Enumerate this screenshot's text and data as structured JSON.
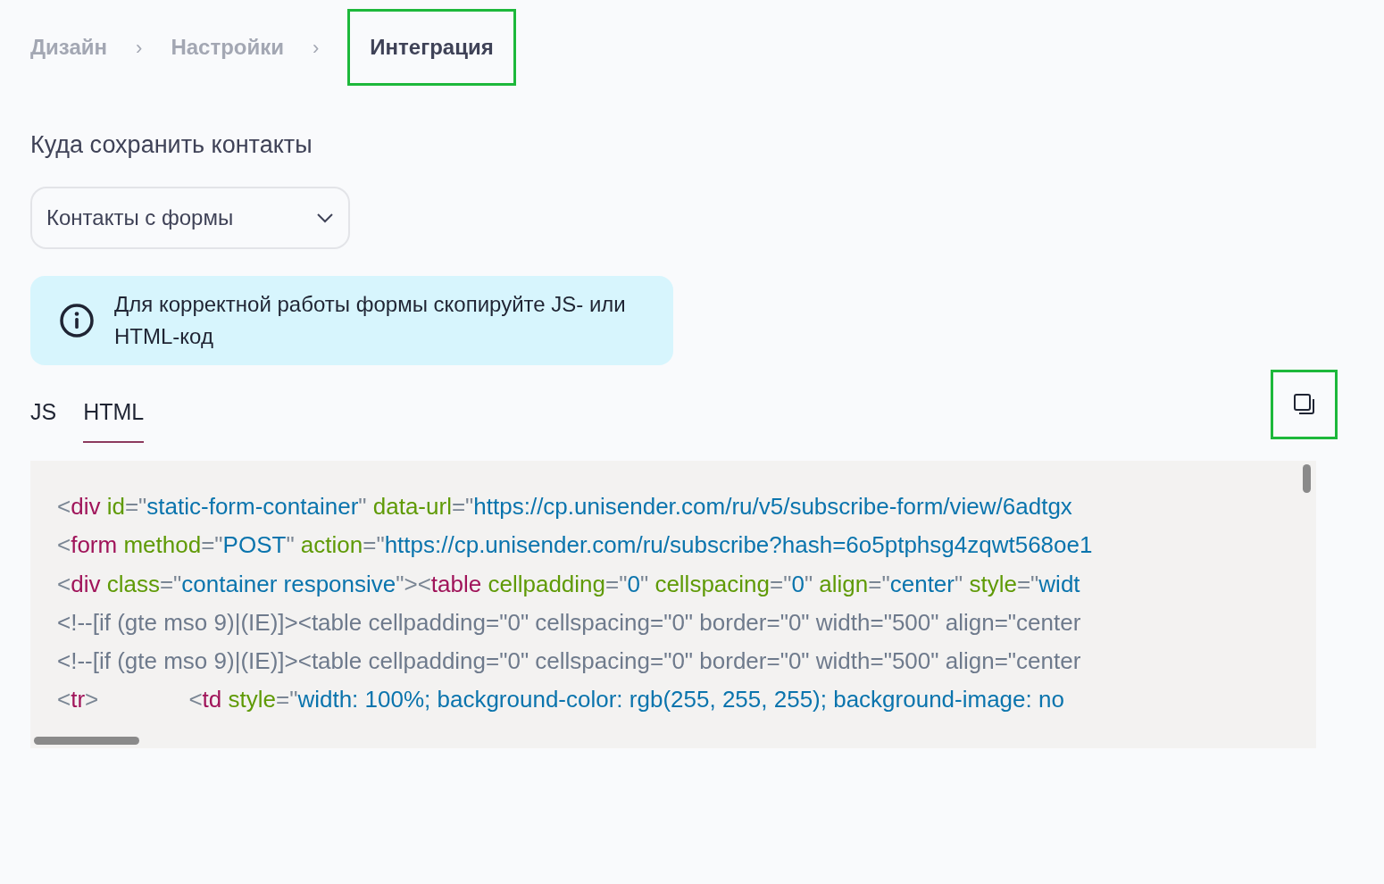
{
  "breadcrumbs": [
    {
      "label": "Дизайн",
      "selected": false,
      "highlighted": false,
      "separator": "›"
    },
    {
      "label": "Настройки",
      "selected": false,
      "highlighted": false,
      "separator": "›"
    },
    {
      "label": "Интеграция",
      "selected": true,
      "highlighted": true
    }
  ],
  "section_title": "Куда сохранить контакты",
  "select": {
    "value": "Контакты с формы"
  },
  "info": {
    "text": "Для корректной работы формы скопируйте JS- или HTML-код"
  },
  "tabs": [
    {
      "label": "JS",
      "selected": false
    },
    {
      "label": "HTML",
      "selected": true
    }
  ],
  "copy_button": {
    "highlighted": true
  },
  "code_lines": [
    [
      {
        "kind": "punct",
        "text": "<"
      },
      {
        "kind": "tag",
        "text": "div "
      },
      {
        "kind": "attr",
        "text": "id"
      },
      {
        "kind": "punct",
        "text": "=\""
      },
      {
        "kind": "value",
        "text": "static-form-container"
      },
      {
        "kind": "punct",
        "text": "\" "
      },
      {
        "kind": "attr",
        "text": "data-url"
      },
      {
        "kind": "punct",
        "text": "=\""
      },
      {
        "kind": "value",
        "text": "https://cp.unisender.com/ru/v5/subscribe-form/view/6adtgx"
      }
    ],
    [
      {
        "kind": "punct",
        "text": "<"
      },
      {
        "kind": "tag",
        "text": "form "
      },
      {
        "kind": "attr",
        "text": "method"
      },
      {
        "kind": "punct",
        "text": "=\""
      },
      {
        "kind": "value",
        "text": "POST"
      },
      {
        "kind": "punct",
        "text": "\" "
      },
      {
        "kind": "attr",
        "text": "action"
      },
      {
        "kind": "punct",
        "text": "=\""
      },
      {
        "kind": "value",
        "text": "https://cp.unisender.com/ru/subscribe?hash=6o5ptphsg4zqwt568oe1"
      }
    ],
    [
      {
        "kind": "punct",
        "text": "<"
      },
      {
        "kind": "tag",
        "text": "div "
      },
      {
        "kind": "attr",
        "text": "class"
      },
      {
        "kind": "punct",
        "text": "=\""
      },
      {
        "kind": "value",
        "text": "container responsive"
      },
      {
        "kind": "punct",
        "text": "\"><"
      },
      {
        "kind": "tag",
        "text": "table "
      },
      {
        "kind": "attr",
        "text": "cellpadding"
      },
      {
        "kind": "punct",
        "text": "=\""
      },
      {
        "kind": "value",
        "text": "0"
      },
      {
        "kind": "punct",
        "text": "\" "
      },
      {
        "kind": "attr",
        "text": "cellspacing"
      },
      {
        "kind": "punct",
        "text": "=\""
      },
      {
        "kind": "value",
        "text": "0"
      },
      {
        "kind": "punct",
        "text": "\" "
      },
      {
        "kind": "attr",
        "text": "align"
      },
      {
        "kind": "punct",
        "text": "=\""
      },
      {
        "kind": "value",
        "text": "center"
      },
      {
        "kind": "punct",
        "text": "\" "
      },
      {
        "kind": "attr",
        "text": "style"
      },
      {
        "kind": "punct",
        "text": "=\""
      },
      {
        "kind": "value",
        "text": "widt"
      }
    ],
    [
      {
        "kind": "comment",
        "text": "<!--[if (gte mso 9)|(IE)]><table cellpadding=\"0\" cellspacing=\"0\" border=\"0\" width=\"500\" align=\"center"
      }
    ],
    [
      {
        "kind": "comment",
        "text": "<!--[if (gte mso 9)|(IE)]><table cellpadding=\"0\" cellspacing=\"0\" border=\"0\" width=\"500\" align=\"center"
      }
    ],
    [
      {
        "kind": "punct",
        "text": "<"
      },
      {
        "kind": "tag",
        "text": "tr"
      },
      {
        "kind": "punct",
        "text": ">              <"
      },
      {
        "kind": "tag",
        "text": "td "
      },
      {
        "kind": "attr",
        "text": "style"
      },
      {
        "kind": "punct",
        "text": "=\""
      },
      {
        "kind": "value",
        "text": "width: 100%; background-color: rgb(255, 255, 255); background-image: no"
      }
    ]
  ]
}
